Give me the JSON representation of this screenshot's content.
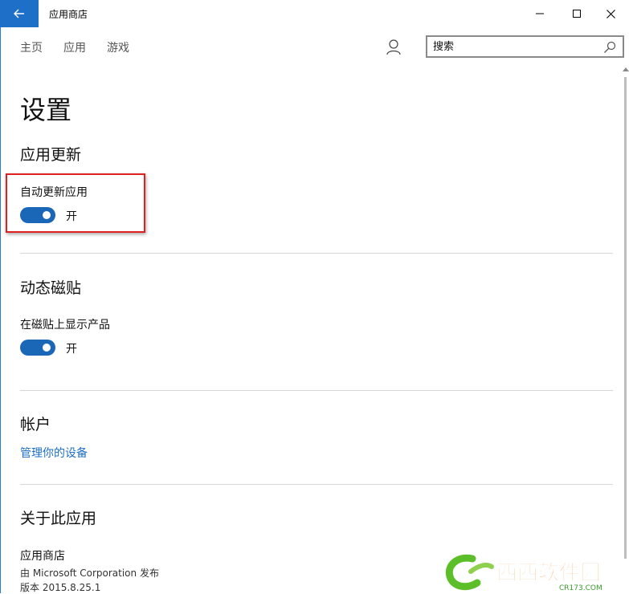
{
  "window": {
    "title": "应用商店",
    "back_icon": "back-arrow-icon"
  },
  "nav": {
    "items": [
      {
        "label": "主页"
      },
      {
        "label": "应用"
      },
      {
        "label": "游戏"
      }
    ],
    "search": {
      "value": "",
      "placeholder": "搜索"
    }
  },
  "page": {
    "title": "设置"
  },
  "sections": {
    "app_updates": {
      "title": "应用更新",
      "setting_label": "自动更新应用",
      "toggle_state": "开",
      "toggle_on": true
    },
    "live_tiles": {
      "title": "动态磁贴",
      "setting_label": "在磁贴上显示产品",
      "toggle_state": "开",
      "toggle_on": true
    },
    "account": {
      "title": "帐户",
      "link": "管理你的设备"
    },
    "about": {
      "title": "关于此应用",
      "app_name": "应用商店",
      "publisher": "由 Microsoft Corporation 发布",
      "version": "版本 2015.8.25.1"
    }
  },
  "watermark": {
    "text": "西西软件园",
    "subtext": "CR173.COM"
  },
  "colors": {
    "accent": "#1e6fc7",
    "toggle_on": "#1a67b8",
    "highlight": "#e02020"
  }
}
